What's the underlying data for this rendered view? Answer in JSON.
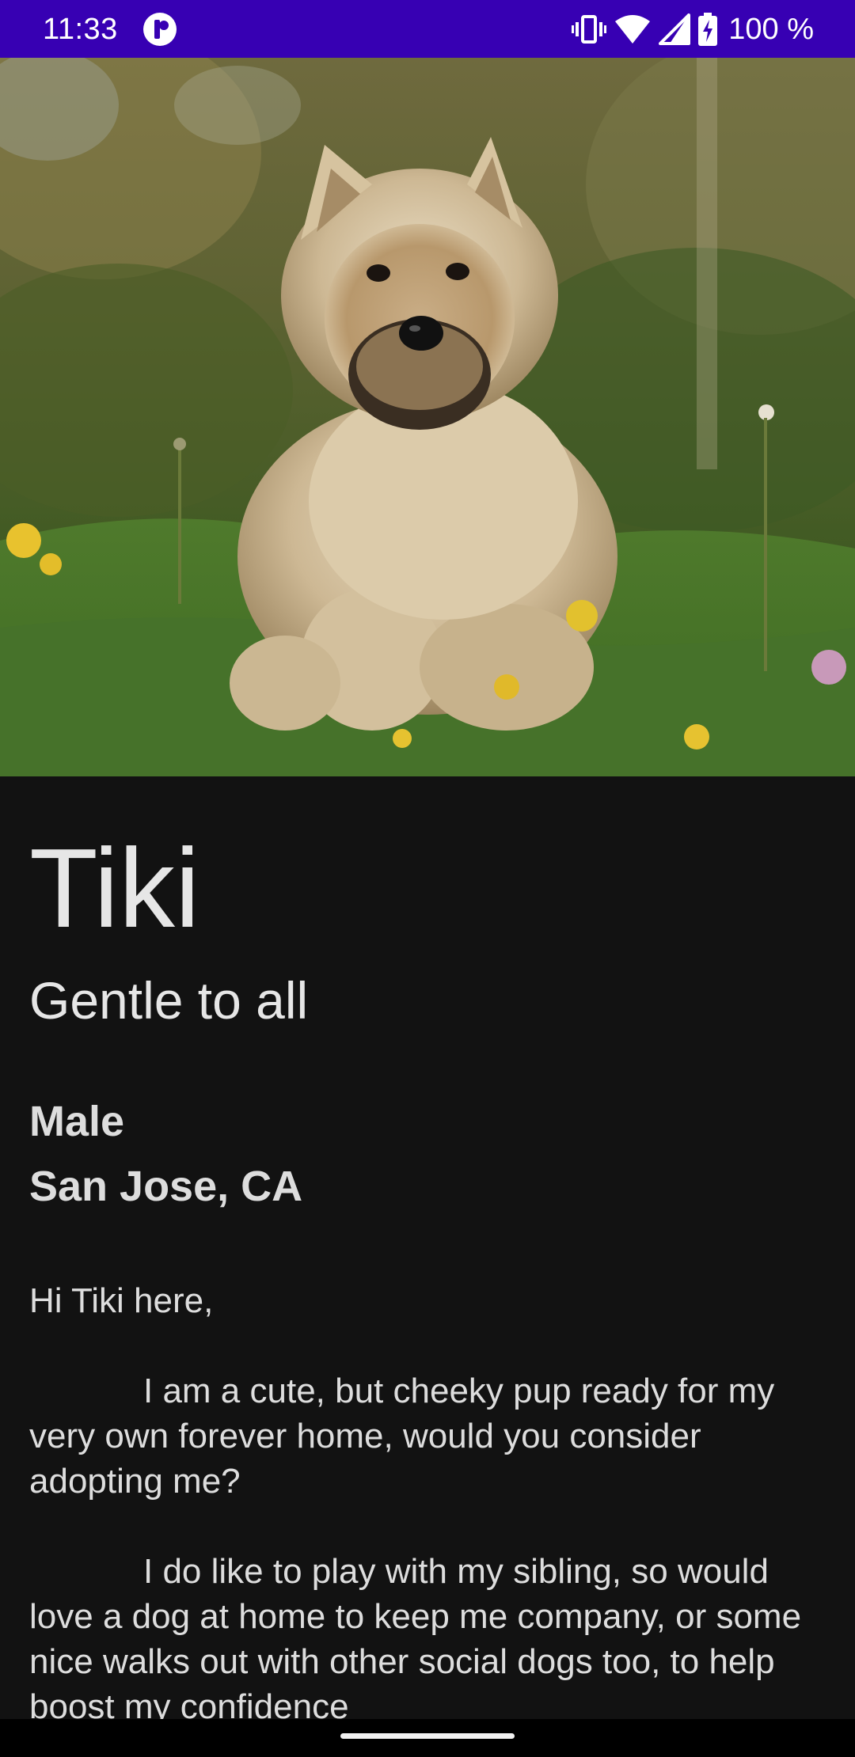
{
  "status_bar": {
    "time": "11:33",
    "battery": "100 %",
    "icons": [
      "app-notification-icon",
      "vibrate-icon",
      "wifi-icon",
      "cell-signal-icon",
      "battery-charging-icon"
    ],
    "background": "#3700b3"
  },
  "hero_image": {
    "description": "dog-photo",
    "icon": "dog-photo"
  },
  "pet": {
    "name": "Tiki",
    "tagline": "Gentle to all",
    "gender": "Male",
    "location": "San Jose, CA",
    "bio": "Hi Tiki here,\n\n\t\tI am a cute, but cheeky pup ready for my very own forever home, would you consider adopting me?\n\n\t\tI do like to play with my sibling, so would love a dog at home to keep me company, or some nice walks out with other social dogs too, to help boost my confidence"
  },
  "colors": {
    "background": "#121212",
    "text": "#e6e6e6"
  }
}
